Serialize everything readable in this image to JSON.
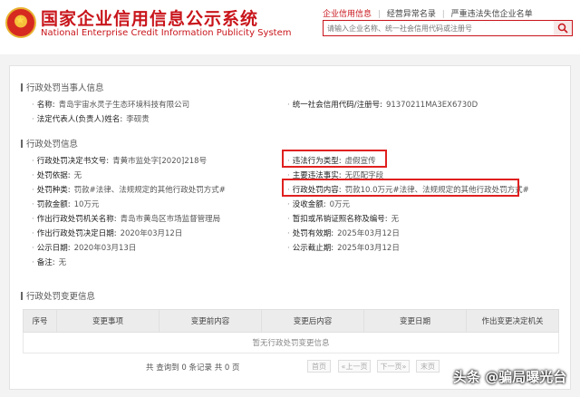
{
  "header": {
    "title_cn": "国家企业信用信息公示系统",
    "title_en": "National Enterprise Credit Information Publicity System",
    "nav": [
      "企业信用信息",
      "经营异常名录",
      "严重违法失信企业名单"
    ],
    "search_placeholder": "请输入企业名称、统一社会信用代码或注册号"
  },
  "party": {
    "section_title": "行政处罚当事人信息",
    "name_label": "名称:",
    "name_value": "青岛宇宙水灵子生态环境科技有限公司",
    "credit_label": "统一社会信用代码/注册号:",
    "credit_value": "91370211MA3EX6730D",
    "rep_label": "法定代表人(负责人)姓名:",
    "rep_value": "李砚贵"
  },
  "penalty": {
    "section_title": "行政处罚信息",
    "doc_no_label": "行政处罚决定书文号:",
    "doc_no_value": "青黄市监处字[2020]218号",
    "violation_type_label": "违法行为类型:",
    "violation_type_value": "虚假宣传",
    "basis_label": "处罚依据:",
    "basis_value": "无",
    "main_facts_label": "主要违法事实:",
    "main_facts_value": "无匹配字段",
    "kind_label": "处罚种类:",
    "kind_value": "罚款#法律、法规规定的其他行政处罚方式#",
    "content_label": "行政处罚内容:",
    "content_value": "罚款10.0万元#法律、法规规定的其他行政处罚方式#",
    "amount_label": "罚款金额:",
    "amount_value": "10万元",
    "confiscation_label": "没收金额:",
    "confiscation_value": "0万元",
    "authority_label": "作出行政处罚机关名称:",
    "authority_value": "青岛市黄岛区市场监督管理局",
    "license_label": "暂扣或吊销证照名称及编号:",
    "license_value": "无",
    "decision_date_label": "作出行政处罚决定日期:",
    "decision_date_value": "2020年03月12日",
    "valid_label": "处罚有效期:",
    "valid_value": "2025年03月12日",
    "publish_date_label": "公示日期:",
    "publish_date_value": "2020年03月13日",
    "publish_end_label": "公示截止期:",
    "publish_end_value": "2025年03月12日",
    "remark_label": "备注:",
    "remark_value": "无"
  },
  "changes": {
    "section_title": "行政处罚变更信息",
    "columns": [
      "序号",
      "变更事项",
      "变更前内容",
      "变更后内容",
      "变更日期",
      "作出变更决定机关"
    ],
    "empty_text": "暂无行政处罚变更信息",
    "pager_text": "共 查询到 0 条记录 共 0 页",
    "pager_buttons": [
      "首页",
      "«上一页",
      "下一页»",
      "末页"
    ]
  },
  "watermark": "头条 @骗局曝光台",
  "colors": {
    "brand_red": "#c8151b",
    "highlight_red": "#e02020"
  }
}
